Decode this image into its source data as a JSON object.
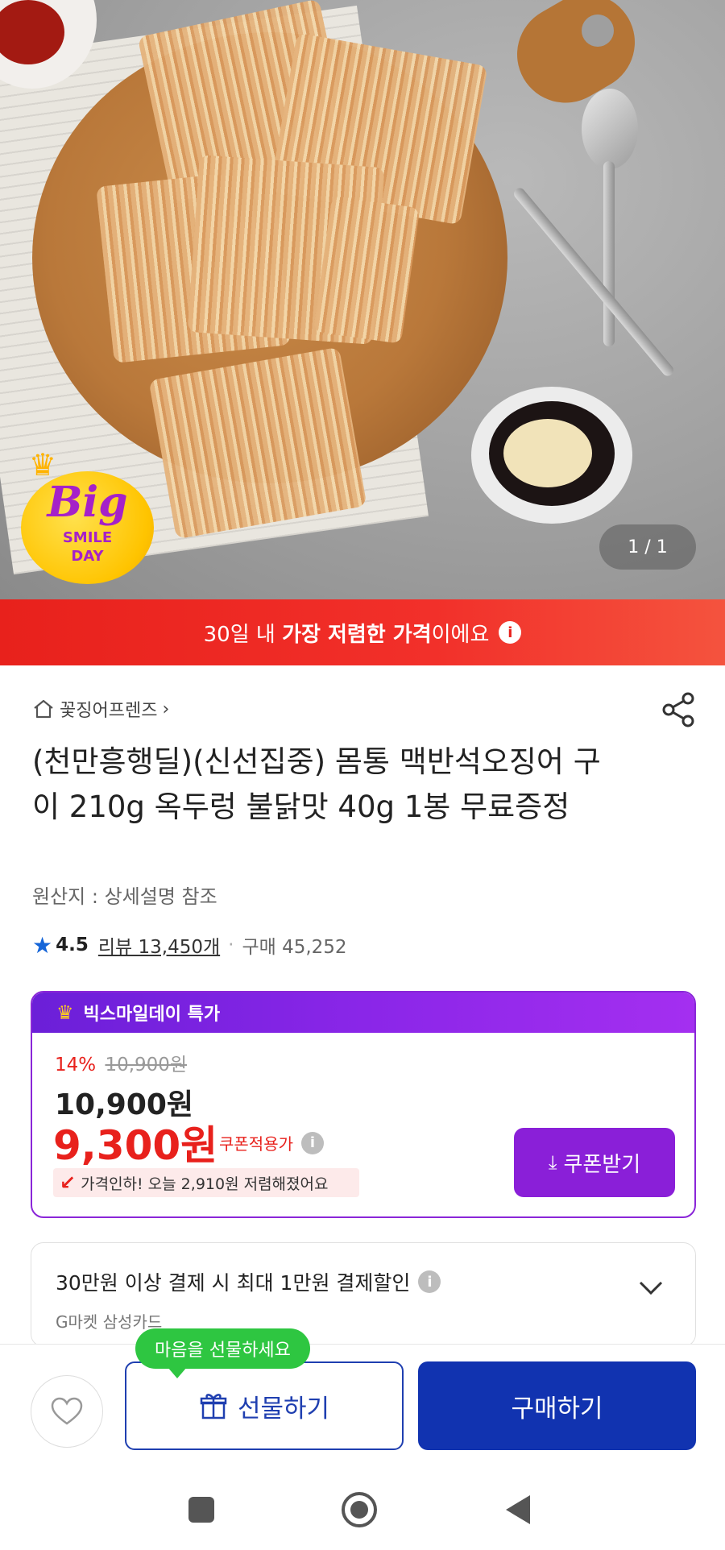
{
  "hero": {
    "badge": {
      "word": "Big",
      "line1": "SMILE",
      "line2": "DAY"
    },
    "image_counter": "1 / 1"
  },
  "banner": {
    "prefix": "30일 내 ",
    "highlight": "가장 저렴한 가격",
    "suffix": "이에요",
    "info_glyph": "i"
  },
  "seller": {
    "name": "꽃징어프렌즈",
    "chevron": "›",
    "icon": "home-icon"
  },
  "product": {
    "title": "(천만흥행딜)(신선집중) 몸통 맥반석오징어 구이 210g 옥두렁 불닭맛 40g 1봉 무료증정",
    "origin": "원산지 : 상세설명 참조"
  },
  "rating": {
    "star_glyph": "★",
    "value": "4.5",
    "review": "리뷰 13,450개",
    "separator": "·",
    "purchase": "구매 45,252"
  },
  "deal": {
    "header_label": "빅스마일데이 특가",
    "crown_glyph": "♛",
    "discount_pct": "14%",
    "original_price": "10,900원",
    "price": "10,900원",
    "coupon_price": "9,300원",
    "coupon_label": "쿠폰적용가",
    "info_glyph": "i",
    "price_down_arrow": "↙",
    "price_down_text": "가격인하! 오늘 2,910원 저렴해졌어요",
    "coupon_button": "쿠폰받기",
    "coupon_button_icon": "⤓"
  },
  "card_promo": {
    "line1": "30만원 이상 결제 시 최대 1만원 결제할인",
    "line2": "G마켓 삼성카드",
    "info_glyph": "i"
  },
  "actions": {
    "gift_tooltip": "마음을 선물하세요",
    "gift_label": "선물하기",
    "buy_label": "구매하기"
  },
  "colors": {
    "banner_red": "#e8211c",
    "deal_purple": "#8a26d8",
    "buy_blue": "#1133b0",
    "tooltip_green": "#2ec641",
    "rating_star": "#1565d8"
  }
}
